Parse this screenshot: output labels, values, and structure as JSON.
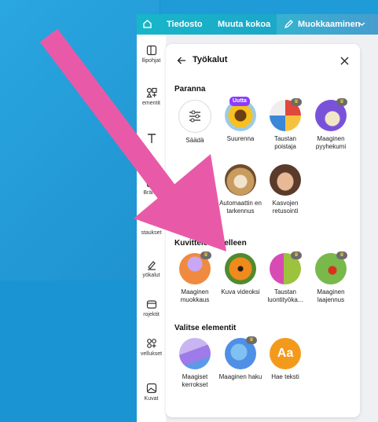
{
  "topbar": {
    "file_label": "Tiedosto",
    "resize_label": "Muuta kokoa",
    "edit_label": "Muokkaaminen"
  },
  "sidebar": {
    "items": [
      {
        "label": "llipohjat",
        "icon": "template-icon"
      },
      {
        "label": "ementit",
        "icon": "elements-icon"
      },
      {
        "label": "",
        "icon": "text-icon"
      },
      {
        "label": "Brändi",
        "icon": "brand-icon"
      },
      {
        "label": "staukset",
        "icon": "uploads-icon"
      },
      {
        "label": "yökalut",
        "icon": "draw-icon"
      },
      {
        "label": "rojektit",
        "icon": "projects-icon"
      },
      {
        "label": "vellukset",
        "icon": "apps-icon"
      },
      {
        "label": "Kuvat",
        "icon": "photos-icon"
      },
      {
        "label": "",
        "icon": "music-icon"
      }
    ]
  },
  "panel": {
    "title": "Työkalut",
    "sections": [
      {
        "title": "Paranna",
        "tools": [
          {
            "label": "Säädä",
            "icon": "adjust-icon",
            "color": "#ffffff"
          },
          {
            "label": "Suurenna",
            "badge": "Uutta",
            "icon": "sunflower-icon",
            "color": "#f2a81a"
          },
          {
            "label": "Taustan poistaja",
            "crown": true,
            "icon": "ball-icon",
            "color": "#3a86d8"
          },
          {
            "label": "Maaginen pyyhekumi",
            "crown": true,
            "icon": "eraser-icon",
            "color": "#7a52d9"
          }
        ]
      },
      {
        "title": "",
        "tools": [
          {
            "label": "Automaattin en tarkennus",
            "icon": "dog-icon",
            "color": "#c89b5e"
          },
          {
            "label": "Kasvojen retusointi",
            "icon": "face-icon",
            "color": "#d6a483"
          }
        ]
      },
      {
        "title": "Kuvittele uudelleen",
        "tools": [
          {
            "label": "Maaginen muokkaus",
            "crown": true,
            "icon": "cupcake-icon",
            "color": "#f08a3e"
          },
          {
            "label": "Kuva videoksi",
            "icon": "butterfly-icon",
            "color": "#4f8a2e"
          },
          {
            "label": "Taustan luontityöka...",
            "crown": true,
            "icon": "bottle-icon",
            "color": "#d94bb4"
          },
          {
            "label": "Maaginen laajennus",
            "crown": true,
            "icon": "ladybug-icon",
            "color": "#79b84a"
          }
        ]
      },
      {
        "title": "Valitse elementit",
        "tools": [
          {
            "label": "Maagiset kerrokset",
            "icon": "layers-icon",
            "color": "#9d7be8"
          },
          {
            "label": "Maaginen haku",
            "crown": true,
            "icon": "globe-icon",
            "color": "#4f8fe6"
          },
          {
            "label": "Hae teksti",
            "icon": "text-grab-icon",
            "text": "Aa",
            "color": "#f39a1c"
          }
        ]
      }
    ]
  },
  "arrow_color": "#e85aa8"
}
